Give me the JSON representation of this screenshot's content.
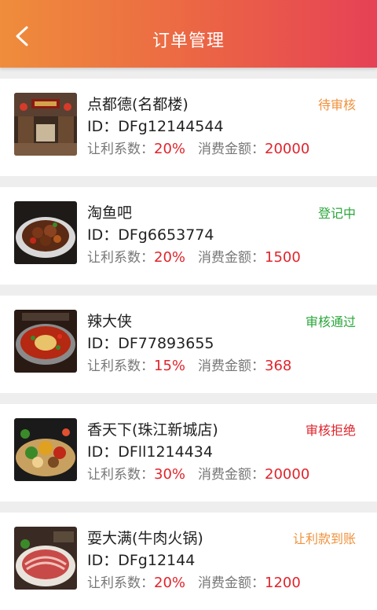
{
  "header": {
    "title": "订单管理",
    "back_icon": "chevron-left-icon"
  },
  "colors": {
    "status_pending": "#f0913c",
    "status_registering": "#2aa63b",
    "status_approved": "#2aa63b",
    "status_rejected": "#e0242b",
    "status_settled": "#f0913c",
    "value_red": "#e0242b"
  },
  "labels": {
    "discount": "让利系数：",
    "amount": "消费金额：",
    "id_prefix": "ID："
  },
  "orders": [
    {
      "name": "点都德(名都楼)",
      "id": "DFg12144544",
      "discount": "20%",
      "amount": "20000",
      "status": "待审核"
    },
    {
      "name": "淘鱼吧",
      "id": "DFg6653774",
      "discount": "20%",
      "amount": "1500",
      "status": "登记中"
    },
    {
      "name": "辣大侠",
      "id": "DF77893655",
      "discount": "15%",
      "amount": "368",
      "status": "审核通过"
    },
    {
      "name": "香天下(珠江新城店)",
      "id": "DFll1214434",
      "discount": "30%",
      "amount": "20000",
      "status": "审核拒绝"
    },
    {
      "name": "耍大满(牛肉火锅)",
      "id": "DFg12144",
      "discount": "20%",
      "amount": "1200",
      "status": "让利款到账"
    }
  ]
}
